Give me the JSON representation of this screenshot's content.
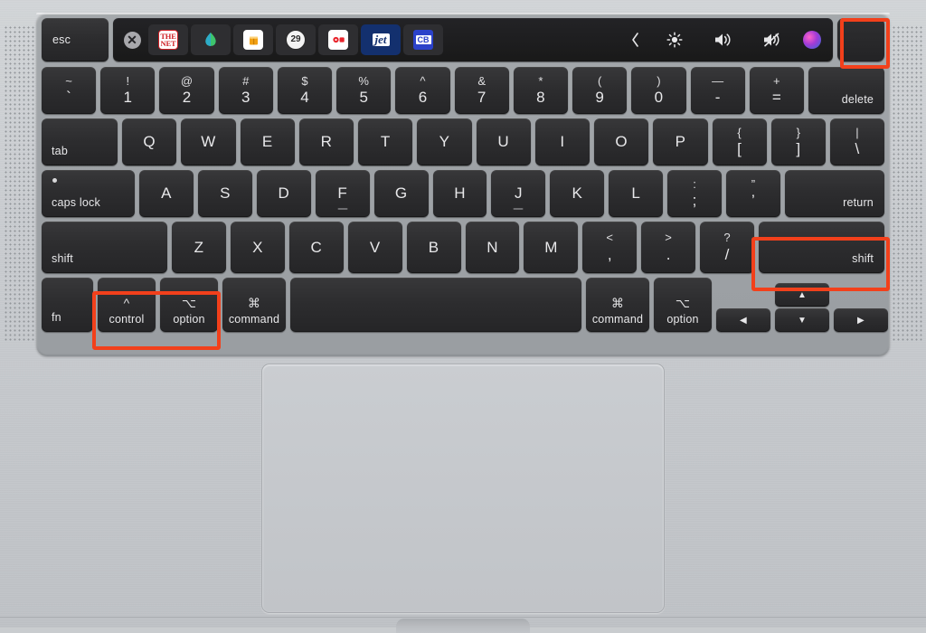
{
  "device": {
    "name": "MacBook Pro 16-inch Magic Keyboard",
    "body_color": "#c9cccf",
    "key_color": "#2d2d2f",
    "highlight_color": "#f2401b"
  },
  "touchbar": {
    "close_label": "✕",
    "apps": [
      {
        "name": "the-net-app-icon",
        "label": "THE\nNET"
      },
      {
        "name": "leaf-app-icon",
        "label": "◆"
      },
      {
        "name": "cup-app-icon",
        "label": "🥤"
      },
      {
        "name": "badge-app-icon",
        "label": "29"
      },
      {
        "name": "record-app-icon",
        "label": "●"
      },
      {
        "name": "jet-app-icon",
        "label": "jet"
      },
      {
        "name": "cb-app-icon",
        "label": "CB"
      }
    ],
    "controls": [
      {
        "name": "expand-control-strip-icon",
        "label": "‹"
      },
      {
        "name": "brightness-icon",
        "label": "☀"
      },
      {
        "name": "volume-up-icon",
        "label": "🔊"
      },
      {
        "name": "mute-icon",
        "label": "🔇"
      },
      {
        "name": "siri-icon",
        "label": ""
      }
    ]
  },
  "keys": {
    "esc": "esc",
    "delete": "delete",
    "tab": "tab",
    "caps_lock": "caps lock",
    "return": "return",
    "shift_left": "shift",
    "shift_right": "shift",
    "fn": "fn",
    "control": "control",
    "option_left": "option",
    "command_left": "command",
    "command_right": "command",
    "option_right": "option",
    "space": "",
    "glyph_control": "^",
    "glyph_option": "⌥",
    "glyph_command": "⌘",
    "arrow_left": "◀",
    "arrow_right": "▶",
    "arrow_up": "▲",
    "arrow_down": "▼"
  },
  "number_row": [
    {
      "top": "~",
      "bot": "`"
    },
    {
      "top": "!",
      "bot": "1"
    },
    {
      "top": "@",
      "bot": "2"
    },
    {
      "top": "#",
      "bot": "3"
    },
    {
      "top": "$",
      "bot": "4"
    },
    {
      "top": "%",
      "bot": "5"
    },
    {
      "top": "^",
      "bot": "6"
    },
    {
      "top": "&",
      "bot": "7"
    },
    {
      "top": "*",
      "bot": "8"
    },
    {
      "top": "(",
      "bot": "9"
    },
    {
      "top": ")",
      "bot": "0"
    },
    {
      "top": "—",
      "bot": "-"
    },
    {
      "top": "+",
      "bot": "="
    }
  ],
  "qwerty_row": [
    "Q",
    "W",
    "E",
    "R",
    "T",
    "Y",
    "U",
    "I",
    "O",
    "P"
  ],
  "qwerty_row_symbols": [
    {
      "top": "{",
      "bot": "["
    },
    {
      "top": "}",
      "bot": "]"
    },
    {
      "top": "|",
      "bot": "\\"
    }
  ],
  "home_row": [
    "A",
    "S",
    "D",
    "F",
    "G",
    "H",
    "J",
    "K",
    "L"
  ],
  "home_row_symbols": [
    {
      "top": ":",
      "bot": ";"
    },
    {
      "top": "”",
      "bot": "’"
    }
  ],
  "bottom_letter_row": [
    "Z",
    "X",
    "C",
    "V",
    "B",
    "N",
    "M"
  ],
  "bottom_letter_symbols": [
    {
      "top": "<",
      "bot": ","
    },
    {
      "top": ">",
      "bot": "."
    },
    {
      "top": "?",
      "bot": "/"
    }
  ],
  "highlights": [
    {
      "name": "touch-id-key",
      "target": "Touch ID / power button"
    },
    {
      "name": "right-shift-key",
      "target": "shift"
    },
    {
      "name": "control-option-keys",
      "target": "control + option"
    }
  ]
}
